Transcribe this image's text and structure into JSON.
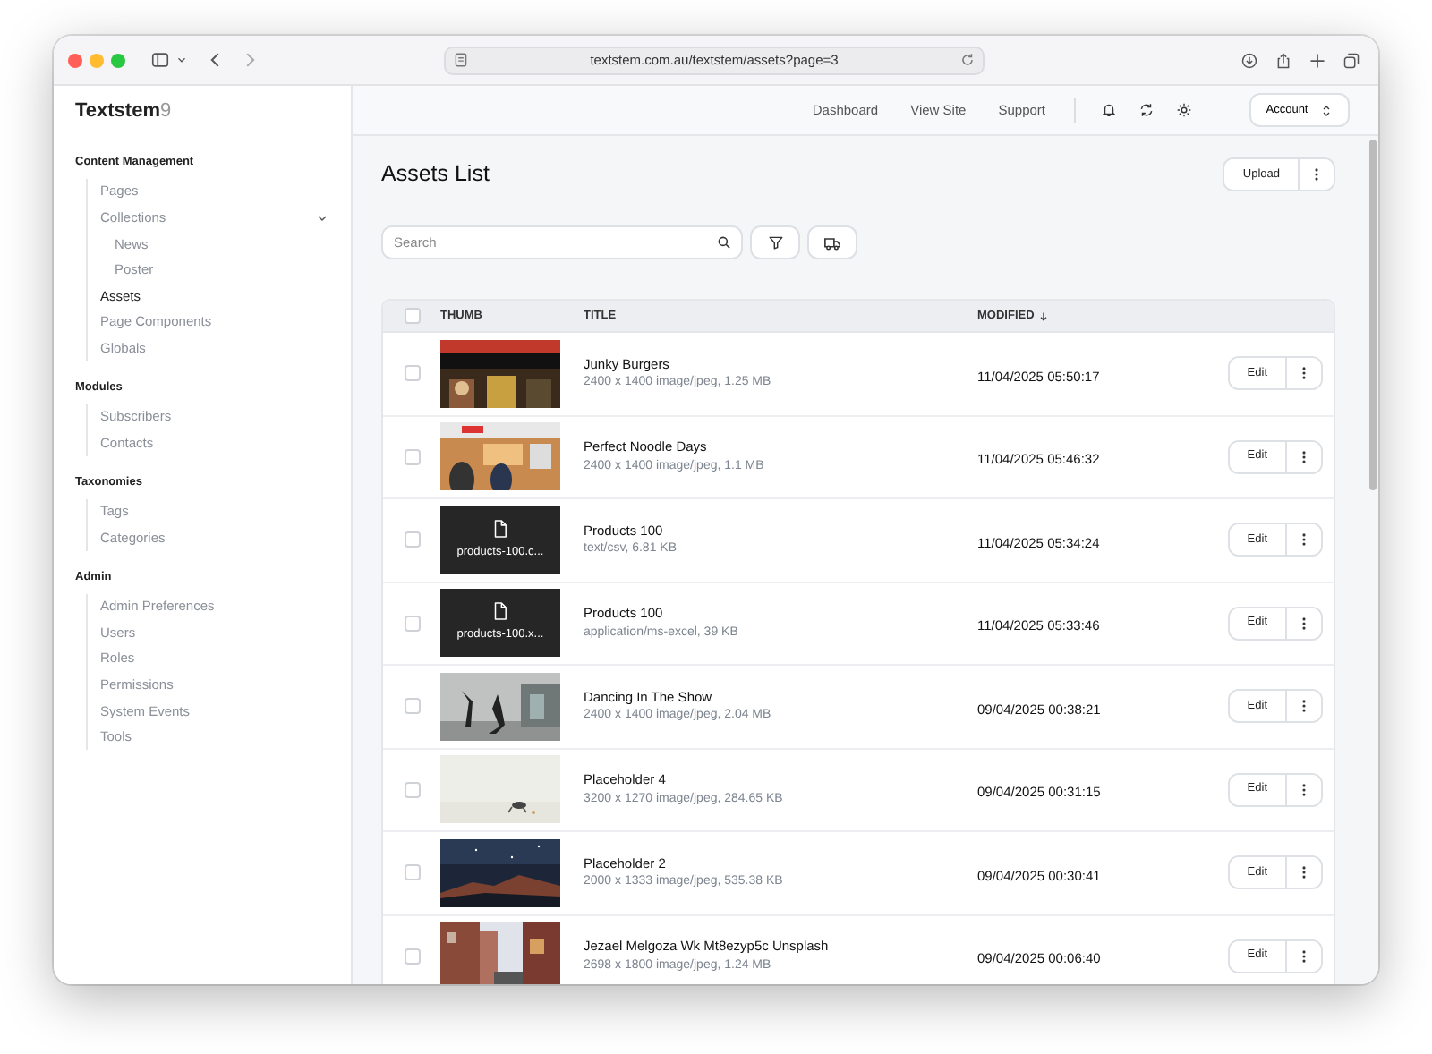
{
  "browser": {
    "url": "textstem.com.au/textstem/assets?page=3"
  },
  "brand": {
    "name": "Textstem",
    "version": "9"
  },
  "sidebar": {
    "sections": [
      {
        "title": "Content Management",
        "items": [
          {
            "label": "Pages",
            "selected": false
          },
          {
            "label": "Collections",
            "selected": false,
            "expanded": true,
            "children": [
              {
                "label": "News",
                "selected": false
              },
              {
                "label": "Poster",
                "selected": false
              }
            ]
          },
          {
            "label": "Assets",
            "selected": true
          },
          {
            "label": "Page Components",
            "selected": false
          },
          {
            "label": "Globals",
            "selected": false
          }
        ]
      },
      {
        "title": "Modules",
        "items": [
          {
            "label": "Subscribers",
            "selected": false
          },
          {
            "label": "Contacts",
            "selected": false
          }
        ]
      },
      {
        "title": "Taxonomies",
        "items": [
          {
            "label": "Tags",
            "selected": false
          },
          {
            "label": "Categories",
            "selected": false
          }
        ]
      },
      {
        "title": "Admin",
        "items": [
          {
            "label": "Admin Preferences",
            "selected": false
          },
          {
            "label": "Users",
            "selected": false
          },
          {
            "label": "Roles",
            "selected": false
          },
          {
            "label": "Permissions",
            "selected": false
          },
          {
            "label": "System Events",
            "selected": false
          },
          {
            "label": "Tools",
            "selected": false
          }
        ]
      }
    ]
  },
  "topnav": {
    "links": [
      "Dashboard",
      "View Site",
      "Support"
    ],
    "account": "Account"
  },
  "page": {
    "title": "Assets List",
    "upload": "Upload"
  },
  "search": {
    "placeholder": "Search"
  },
  "table": {
    "select_all": {
      "checked": false
    },
    "columns": [
      {
        "label": "THUMB"
      },
      {
        "label": "TITLE"
      },
      {
        "label": "MODIFIED",
        "sorted_descending": true
      }
    ],
    "rows": [
      {
        "title": "Junky Burgers",
        "meta": "2400 x 1400 image/jpeg, 1.25 MB",
        "modified": "11/04/2025 05:50:17",
        "action": "Edit",
        "selected": false
      },
      {
        "title": "Perfect Noodle Days",
        "meta": "2400 x 1400 image/jpeg, 1.1 MB",
        "modified": "11/04/2025 05:46:32",
        "action": "Edit",
        "selected": false
      },
      {
        "kind": "file",
        "thumb_label": "products-100.c...",
        "title": "Products 100",
        "meta": "text/csv, 6.81 KB",
        "modified": "11/04/2025 05:34:24",
        "action": "Edit",
        "selected": false
      },
      {
        "kind": "file",
        "thumb_label": "products-100.x...",
        "title": "Products 100",
        "meta": "application/ms-excel, 39 KB",
        "modified": "11/04/2025 05:33:46",
        "action": "Edit",
        "selected": false
      },
      {
        "title": "Dancing In The Show",
        "meta": "2400 x 1400 image/jpeg, 2.04 MB",
        "modified": "09/04/2025 00:38:21",
        "action": "Edit",
        "selected": false
      },
      {
        "title": "Placeholder 4",
        "meta": "3200 x 1270 image/jpeg, 284.65 KB",
        "modified": "09/04/2025 00:31:15",
        "action": "Edit",
        "selected": false
      },
      {
        "title": "Placeholder 2",
        "meta": "2000 x 1333 image/jpeg, 535.38 KB",
        "modified": "09/04/2025 00:30:41",
        "action": "Edit",
        "selected": false
      },
      {
        "title": "Jezael Melgoza Wk Mt8ezyp5c Unsplash",
        "meta": "2698 x 1800 image/jpeg, 1.24 MB",
        "modified": "09/04/2025 00:06:40",
        "action": "Edit",
        "selected": false
      }
    ]
  }
}
